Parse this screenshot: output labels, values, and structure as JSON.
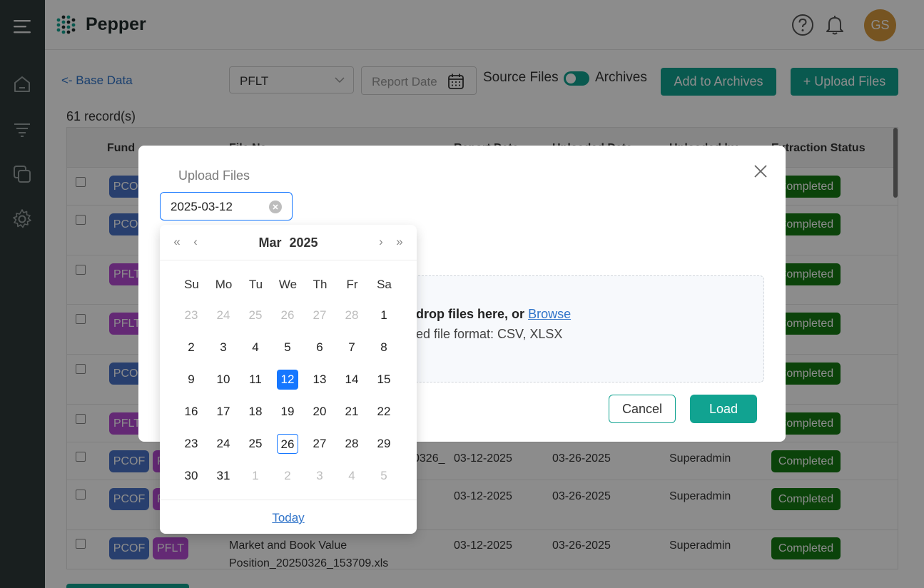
{
  "app": {
    "name": "Pepper",
    "user_initials": "GS"
  },
  "toolbar": {
    "back_label": "<- Base Data",
    "fund_value": "PFLT",
    "report_date_placeholder": "Report Date",
    "source_files_label": "Source Files",
    "archives_label": "Archives",
    "add_archives_label": "Add to Archives",
    "upload_label": "+ Upload Files"
  },
  "records_label": "61 record(s)",
  "table": {
    "columns": [
      "Fund",
      "File Na...",
      "Report Date",
      "Uploaded Date",
      "Uploaded by",
      "Extraction Status"
    ],
    "rows": [
      {
        "tags": [
          "PCOF"
        ],
        "file": "",
        "report_date": "",
        "uploaded_date": "",
        "uploaded_by": "",
        "status": "Completed"
      },
      {
        "tags": [
          "PCOF"
        ],
        "file": "",
        "report_date": "",
        "uploaded_date": "",
        "uploaded_by": "",
        "status": "Completed"
      },
      {
        "tags": [
          "PFLT"
        ],
        "file": "",
        "report_date": "",
        "uploaded_date": "",
        "uploaded_by": "",
        "status": "Completed"
      },
      {
        "tags": [
          "PFLT"
        ],
        "file": "",
        "report_date": "",
        "uploaded_date": "",
        "uploaded_by": "",
        "status": "Completed"
      },
      {
        "tags": [
          "PCOF"
        ],
        "file": "",
        "report_date": "",
        "uploaded_date": "",
        "uploaded_by": "",
        "status": "Completed"
      },
      {
        "tags": [
          "PFLT"
        ],
        "file": "",
        "report_date": "",
        "uploaded_date": "",
        "uploaded_by": "",
        "status": "Completed"
      },
      {
        "tags": [
          "PCOF",
          "PFLT"
        ],
        "file": "0326_",
        "report_date": "03-12-2025",
        "uploaded_date": "03-26-2025",
        "uploaded_by": "Superadmin",
        "status": "Completed"
      },
      {
        "tags": [
          "PCOF",
          "PFLT"
        ],
        "file": "",
        "report_date": "03-12-2025",
        "uploaded_date": "03-26-2025",
        "uploaded_by": "Superadmin",
        "status": "Completed"
      },
      {
        "tags": [
          "PCOF",
          "PFLT"
        ],
        "file": "Market and Book Value",
        "file2": "Position_20250326_153709.xls",
        "report_date": "03-12-2025",
        "uploaded_date": "03-26-2025",
        "uploaded_by": "Superadmin",
        "status": "Completed"
      }
    ]
  },
  "modal": {
    "title": "Upload Files",
    "date_value": "2025-03-12",
    "drop_text": "drop files here, or",
    "browse_label": "Browse",
    "format_text": "ed file format: CSV, XLSX",
    "cancel_label": "Cancel",
    "load_label": "Load"
  },
  "picker": {
    "month": "Mar",
    "year": "2025",
    "weekdays": [
      "Su",
      "Mo",
      "Tu",
      "We",
      "Th",
      "Fr",
      "Sa"
    ],
    "weeks": [
      [
        "23",
        "24",
        "25",
        "26",
        "27",
        "28",
        "1"
      ],
      [
        "2",
        "3",
        "4",
        "5",
        "6",
        "7",
        "8"
      ],
      [
        "9",
        "10",
        "11",
        "12",
        "13",
        "14",
        "15"
      ],
      [
        "16",
        "17",
        "18",
        "19",
        "20",
        "21",
        "22"
      ],
      [
        "23",
        "24",
        "25",
        "26",
        "27",
        "28",
        "29"
      ],
      [
        "30",
        "31",
        "1",
        "2",
        "3",
        "4",
        "5"
      ]
    ],
    "selected": "12",
    "today": "26",
    "today_label": "Today"
  }
}
